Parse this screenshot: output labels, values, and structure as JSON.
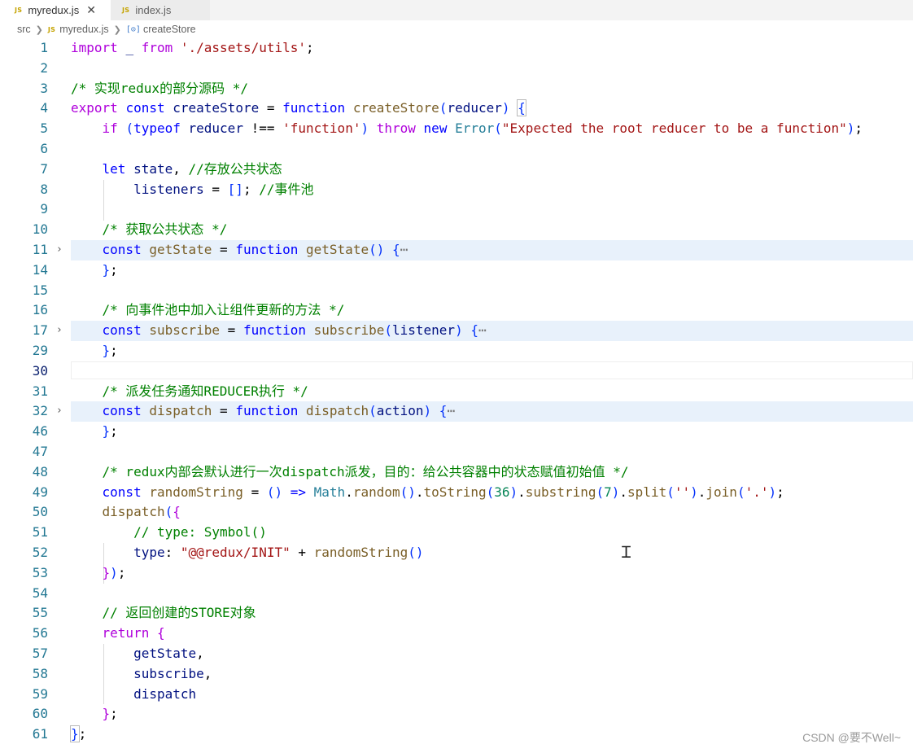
{
  "tabs": [
    {
      "badge": "JS",
      "label": "myredux.js",
      "active": true
    },
    {
      "badge": "JS",
      "label": "index.js",
      "active": false
    }
  ],
  "breadcrumb": {
    "folder": "src",
    "file_badge": "JS",
    "file": "myredux.js",
    "symbol_icon": "[⊙]",
    "symbol": "createStore"
  },
  "editor": {
    "line_numbers": [
      "1",
      "2",
      "3",
      "4",
      "5",
      "6",
      "7",
      "8",
      "9",
      "10",
      "11",
      "14",
      "15",
      "16",
      "17",
      "29",
      "30",
      "31",
      "32",
      "46",
      "47",
      "48",
      "49",
      "50",
      "51",
      "52",
      "53",
      "54",
      "55",
      "56",
      "57",
      "58",
      "59",
      "60",
      "61"
    ],
    "current_line": "30",
    "folded_lines": [
      "11",
      "17",
      "32"
    ]
  },
  "watermark": "CSDN @要不Well~",
  "colors": {
    "keyword": "#0000ff",
    "function": "#795e26",
    "variable": "#001080",
    "string": "#a31515",
    "comment": "#008000",
    "type": "#267f99",
    "number": "#098658",
    "control": "#af00db",
    "line_number": "#237893",
    "fold_highlight": "#e8f1fb"
  }
}
